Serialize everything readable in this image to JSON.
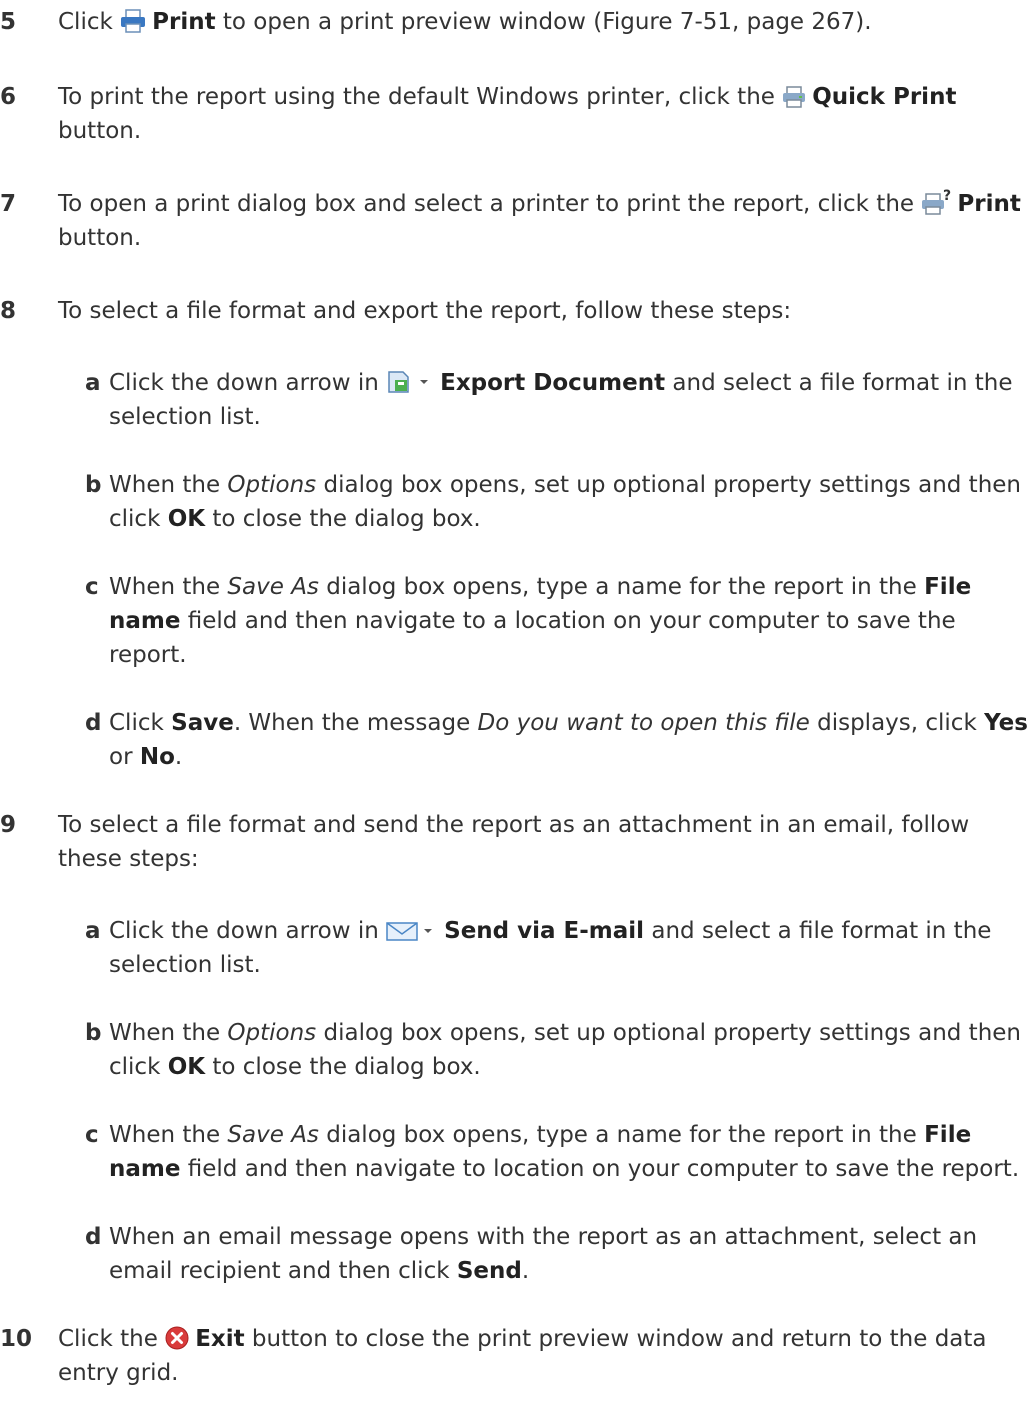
{
  "steps": {
    "s5": {
      "num": "5",
      "p1": "Click ",
      "b1": "Print",
      "p2": " to open a print preview window (Figure 7-51, page 267)."
    },
    "s6": {
      "num": "6",
      "p1": "To print the report using the default Windows printer, click the ",
      "b1": "Quick Print",
      "p2": " button."
    },
    "s7": {
      "num": "7",
      "p1": "To open a print dialog box and select a printer to print the report, click the ",
      "b1": "Print",
      "p2": " button."
    },
    "s8": {
      "num": "8",
      "p1": "To select a file format and export the report, follow these steps:",
      "a": {
        "letter": "a",
        "p1": "Click the down arrow in ",
        "b1": "Export Document",
        "p2": " and select a file format in the selection list."
      },
      "b": {
        "letter": "b",
        "p1": "When the ",
        "i1": "Options",
        "p2": " dialog box opens, set up optional property settings and then click ",
        "b1": "OK",
        "p3": " to close the dialog box."
      },
      "c": {
        "letter": "c",
        "p1": "When the ",
        "i1": "Save As",
        "p2": " dialog box opens, type a name for the report in the ",
        "b1": "File name",
        "p3": " field and then navigate to a location on your computer to save the report."
      },
      "d": {
        "letter": "d",
        "p1": "Click ",
        "b1": "Save",
        "p2": ". When the message ",
        "i1": "Do you want to open this file",
        "p3": " displays, click ",
        "b2": "Yes",
        "p4": " or ",
        "b3": "No",
        "p5": "."
      }
    },
    "s9": {
      "num": "9",
      "p1": "To select a file format and send the report as an attachment in an email, follow these steps:",
      "a": {
        "letter": "a",
        "p1": "Click the down arrow in ",
        "b1": "Send via E-mail",
        "p2": " and select a file format in the selection list."
      },
      "b": {
        "letter": "b",
        "p1": "When the ",
        "i1": "Options",
        "p2": " dialog box opens, set up optional property settings and then click ",
        "b1": "OK",
        "p3": " to close the dialog box."
      },
      "c": {
        "letter": "c",
        "p1": "When the ",
        "i1": "Save As",
        "p2": " dialog box opens, type a name for the report in the ",
        "b1": "File name",
        "p3": " field and then navigate to location on your computer to save the report."
      },
      "d": {
        "letter": "d",
        "p1": "When an email message opens with the report as an attachment, select an email recipient and then click ",
        "b1": "Send",
        "p2": "."
      }
    },
    "s10": {
      "num": "10",
      "p1": "Click the ",
      "b1": "Exit",
      "p2": " button to close the print preview window and return to the data entry grid."
    }
  },
  "icons": {
    "print": "printer-icon",
    "quick_print": "quick-print-icon",
    "print_dialog": "print-dialog-icon",
    "export": "export-document-icon",
    "email": "email-envelope-icon",
    "exit": "exit-icon"
  },
  "colors": {
    "text": "#333333",
    "icon_blue": "#3a78c2",
    "exit_red": "#d93b3b"
  }
}
